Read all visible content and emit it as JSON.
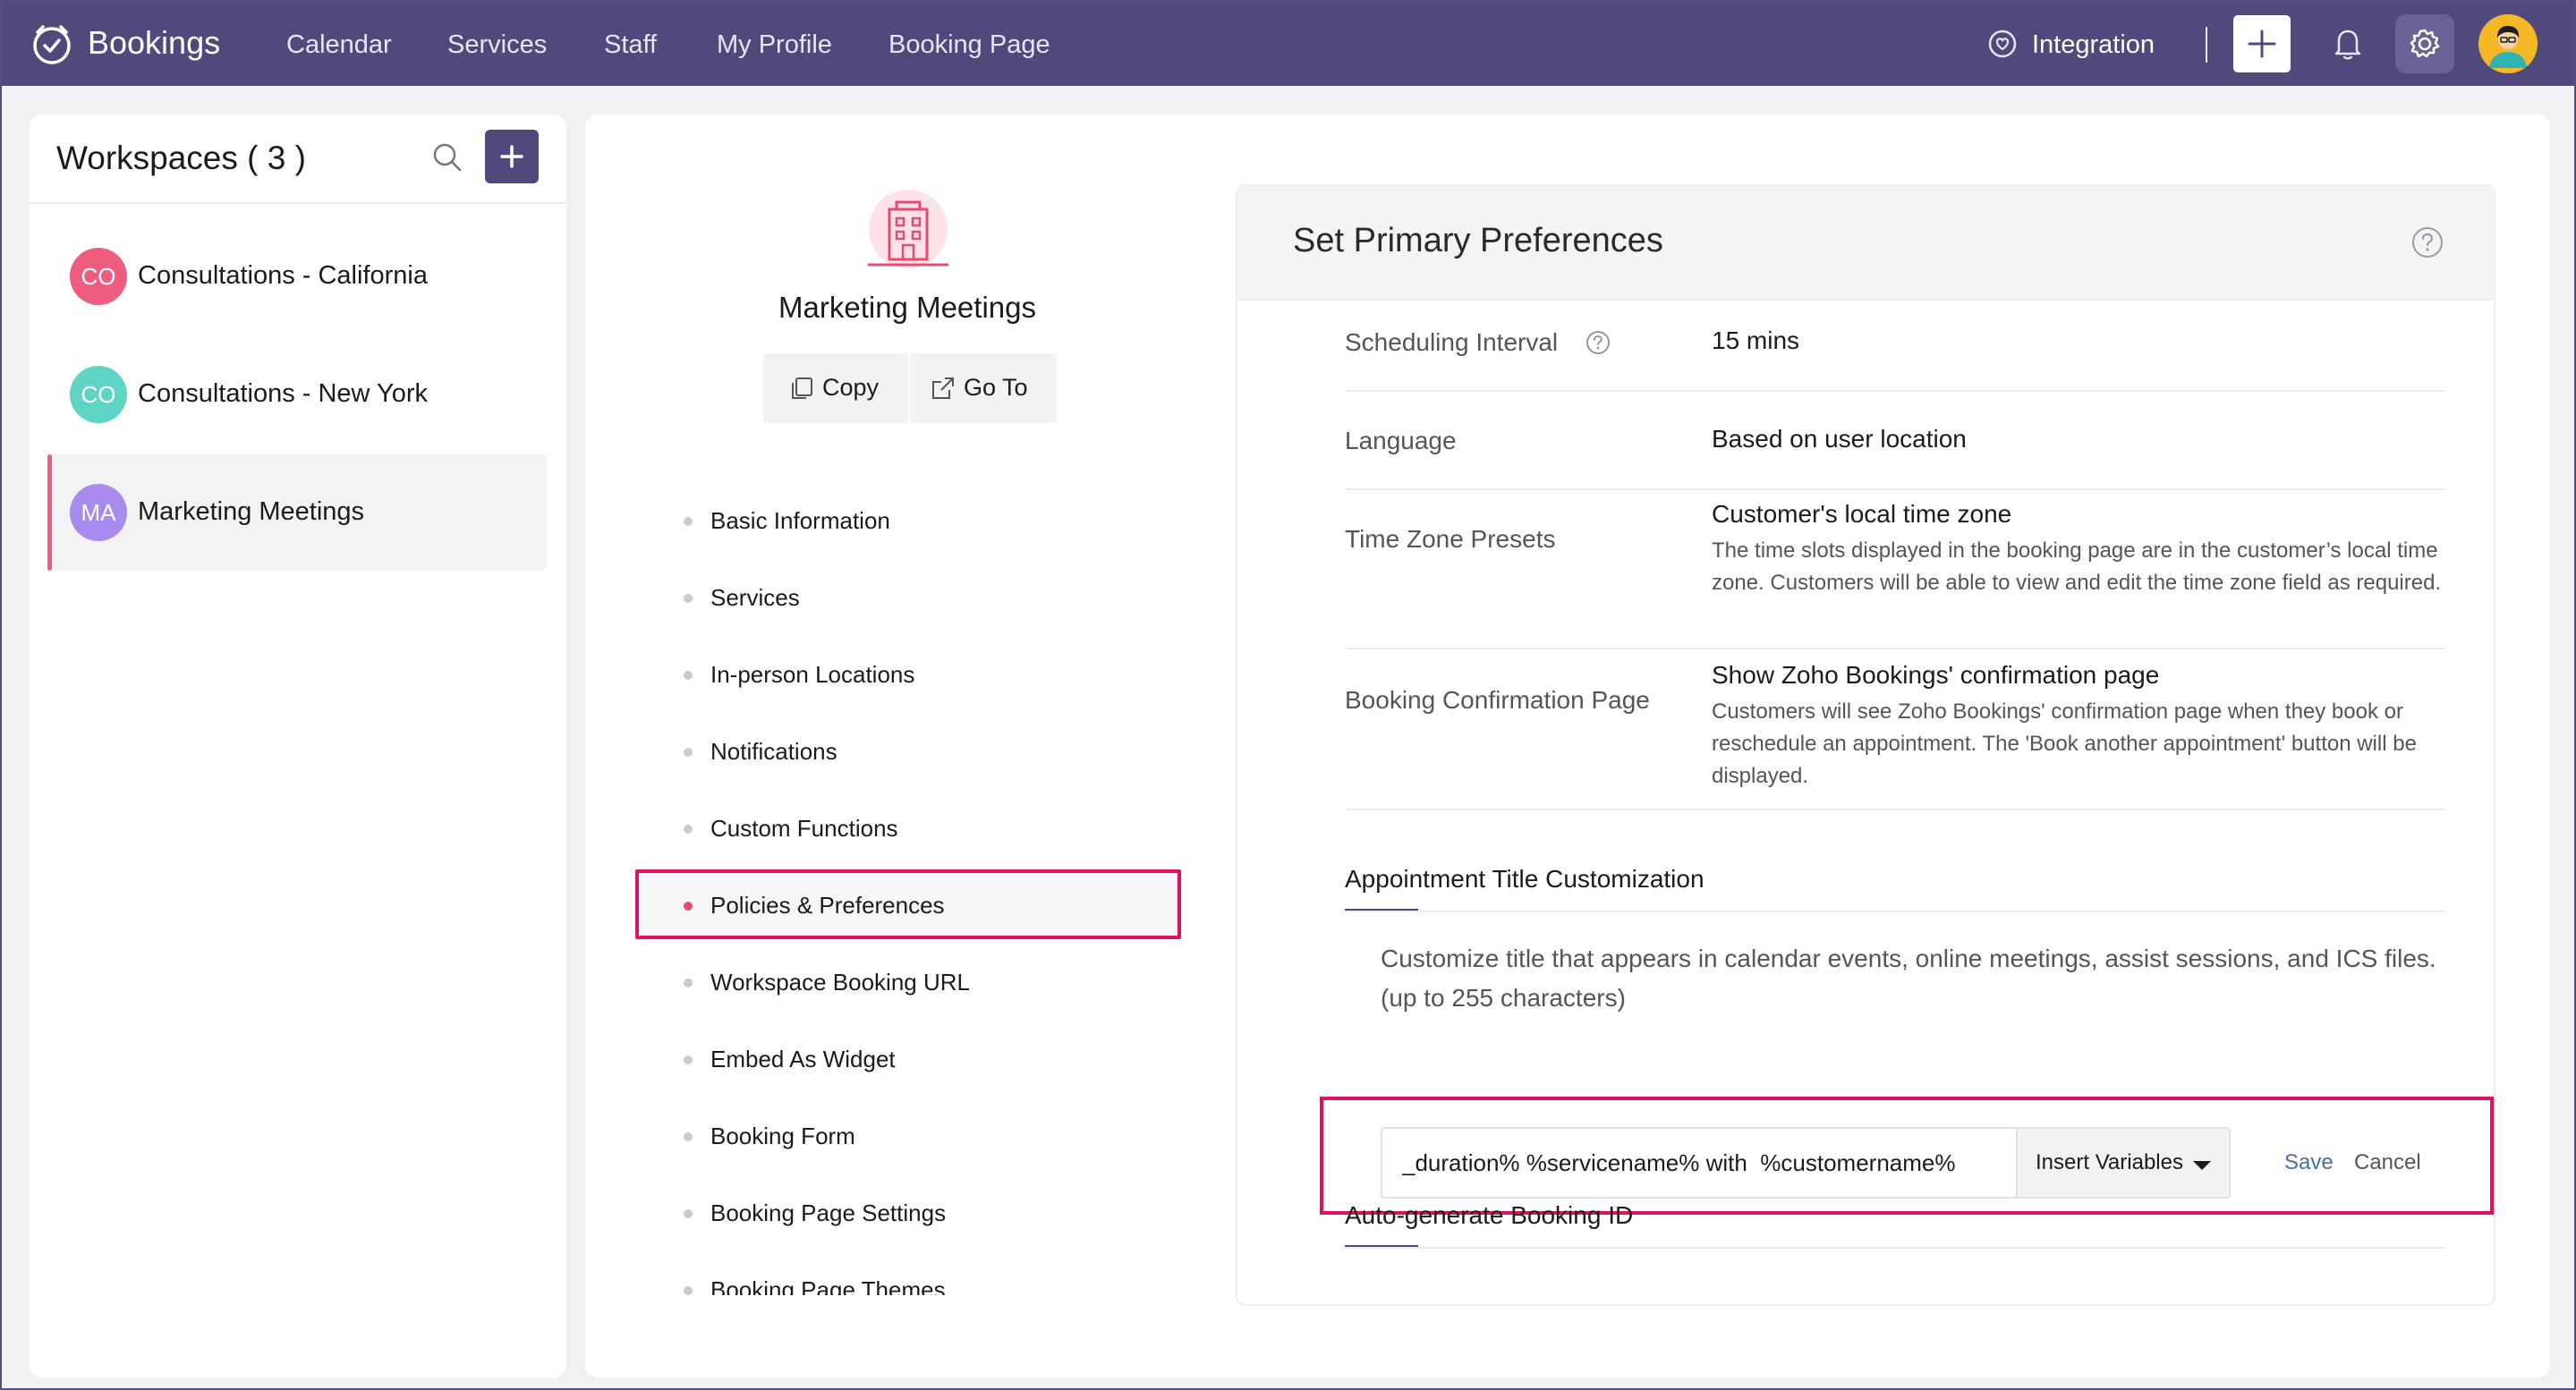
{
  "topbar": {
    "brand": "Bookings",
    "nav": [
      "Calendar",
      "Services",
      "Staff",
      "My Profile",
      "Booking Page"
    ],
    "integration": "Integration",
    "accent": "#51497c"
  },
  "workspaces": {
    "title": "Workspaces ( 3 )",
    "items": [
      {
        "initials": "CO",
        "name": "Consultations - California",
        "color": "#ee5d7f"
      },
      {
        "initials": "CO",
        "name": "Consultations - New York",
        "color": "#5fd3c4"
      },
      {
        "initials": "MA",
        "name": "Marketing Meetings",
        "color": "#a98bef"
      }
    ],
    "selected_index": 2
  },
  "workspace_detail": {
    "name": "Marketing Meetings",
    "copy_label": "Copy",
    "goto_label": "Go To"
  },
  "menu": {
    "items": [
      "Basic Information",
      "Services",
      "In-person Locations",
      "Notifications",
      "Custom Functions",
      "Policies & Preferences",
      "Workspace Booking URL",
      "Embed As Widget",
      "Booking Form",
      "Booking Page Settings",
      "Booking Page Themes"
    ],
    "active_index": 5
  },
  "preferences": {
    "title": "Set Primary Preferences",
    "rows": [
      {
        "label": "Scheduling Interval",
        "value": "15 mins",
        "desc": ""
      },
      {
        "label": "Language",
        "value": "Based on user location",
        "desc": ""
      },
      {
        "label": "Time Zone Presets",
        "value": "Customer's local time zone",
        "desc": "The time slots displayed in the booking page are in the customer’s local time zone. Customers will be able to view and edit the time zone field as required."
      },
      {
        "label": "Booking Confirmation Page",
        "value": "Show Zoho Bookings' confirmation page",
        "desc": "Customers will see Zoho Bookings' confirmation page when they book or reschedule an appointment. The 'Book another appointment' button will be displayed."
      }
    ],
    "title_customization": {
      "heading": "Appointment Title Customization",
      "description": "Customize title that appears in calendar events, online meetings, assist sessions, and ICS files. (up to 255 characters)",
      "input_value": "_duration% %servicename% with  %customername%",
      "insert_label": "Insert Variables",
      "save_label": "Save",
      "cancel_label": "Cancel"
    },
    "booking_id_heading": "Auto-generate Booking ID"
  }
}
